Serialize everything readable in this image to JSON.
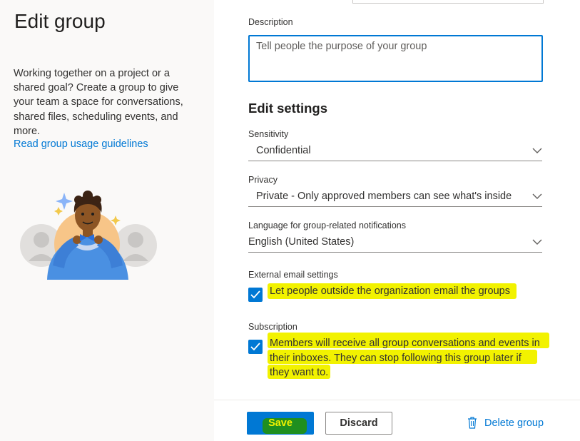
{
  "left": {
    "title": "Edit group",
    "description": "Working together on a project or a shared goal? Create a group to give your team a space for conversations, shared files, scheduling events, and more.",
    "link": "Read group usage guidelines"
  },
  "form": {
    "description_label": "Description",
    "description_placeholder": "Tell people the purpose of your group",
    "section_title": "Edit settings",
    "sensitivity": {
      "label": "Sensitivity",
      "value": "Confidential"
    },
    "privacy": {
      "label": "Privacy",
      "value": "Private - Only approved members can see what's inside"
    },
    "language": {
      "label": "Language for group-related notifications",
      "value": "English (United States)"
    },
    "external_email": {
      "label": "External email settings",
      "checked": true,
      "text": "Let people outside the organization email the groups"
    },
    "subscription": {
      "label": "Subscription",
      "checked": true,
      "text_line1": "Members will receive all group conversations and events in",
      "text_line2": "their inboxes. They can stop following this group later if",
      "text_line3": "they want to."
    }
  },
  "footer": {
    "save_label": "Save",
    "discard_label": "Discard",
    "delete_label": "Delete group"
  },
  "colors": {
    "accent": "#0078d4",
    "highlight": "#f2f200",
    "save_highlight": "#1f8f1f",
    "left_bg": "#faf9f8"
  }
}
